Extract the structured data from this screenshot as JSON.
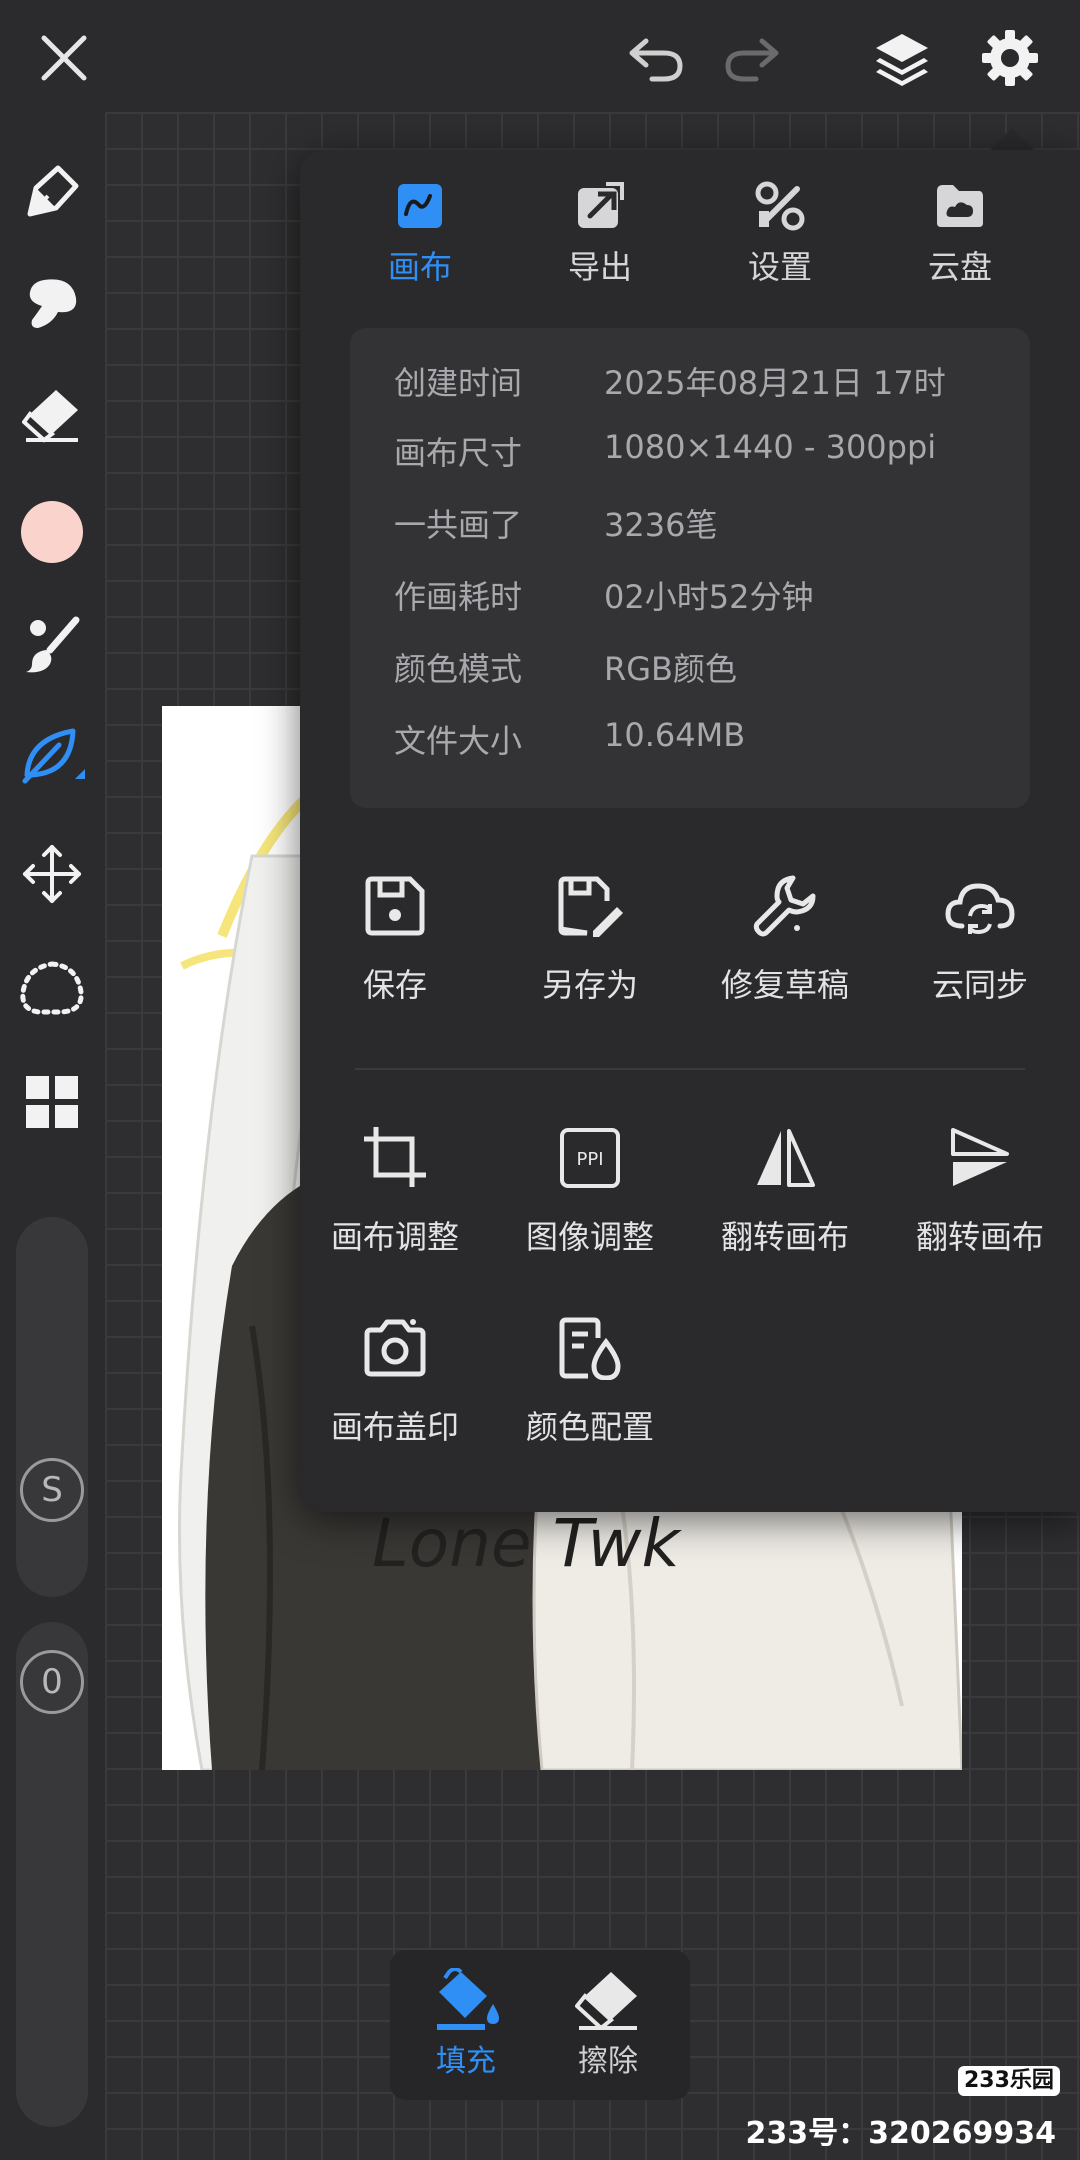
{
  "top_bar": {
    "close_icon": "close-icon",
    "undo_icon": "undo-icon",
    "redo_icon": "redo-icon",
    "layers_icon": "layers-icon",
    "settings_icon": "gear-icon"
  },
  "left_toolbar": {
    "tools": [
      "pen-nib-icon",
      "smudge-icon",
      "eraser-icon",
      "color-swatch",
      "brush-icon",
      "leaf-brush-icon",
      "move-icon",
      "lasso-icon",
      "grid-icon"
    ],
    "active_tool": "leaf-brush-icon",
    "current_color": "#f9d3cc",
    "size_slider_label": "S",
    "opacity_slider_label": "0"
  },
  "panel": {
    "tabs": [
      {
        "label": "画布",
        "icon": "canvas-icon"
      },
      {
        "label": "导出",
        "icon": "export-icon"
      },
      {
        "label": "设置",
        "icon": "tools-icon"
      },
      {
        "label": "云盘",
        "icon": "cloud-drive-icon"
      }
    ],
    "active_tab": "画布",
    "info": [
      {
        "key": "创建时间",
        "value": "2025年08月21日 17时"
      },
      {
        "key": "画布尺寸",
        "value": "1080×1440 - 300ppi"
      },
      {
        "key": "一共画了",
        "value": "3236笔"
      },
      {
        "key": "作画耗时",
        "value": "02小时52分钟"
      },
      {
        "key": "颜色模式",
        "value": "RGB颜色"
      },
      {
        "key": "文件大小",
        "value": "10.64MB"
      }
    ],
    "actions_row1": [
      {
        "label": "保存",
        "icon": "save-icon"
      },
      {
        "label": "另存为",
        "icon": "save-as-icon"
      },
      {
        "label": "修复草稿",
        "icon": "wrench-icon"
      },
      {
        "label": "云同步",
        "icon": "cloud-sync-icon"
      }
    ],
    "actions_row2": [
      {
        "label": "画布调整",
        "icon": "crop-icon"
      },
      {
        "label": "图像调整",
        "icon": "ppi-icon"
      },
      {
        "label": "翻转画布",
        "icon": "flip-horizontal-icon"
      },
      {
        "label": "翻转画布",
        "icon": "flip-vertical-icon"
      }
    ],
    "actions_row3": [
      {
        "label": "画布盖印",
        "icon": "camera-icon"
      },
      {
        "label": "颜色配置",
        "icon": "color-profile-icon"
      }
    ]
  },
  "artwork": {
    "text": "Lone Twk"
  },
  "fill_bar": {
    "fill_label": "填充",
    "erase_label": "擦除",
    "active": "填充"
  },
  "watermark": {
    "logo": "233乐园",
    "text": "233号：320269934"
  },
  "colors": {
    "accent": "#2f8ff5",
    "panel_bg": "#2a2a2c",
    "app_bg": "#2b2b2d"
  }
}
